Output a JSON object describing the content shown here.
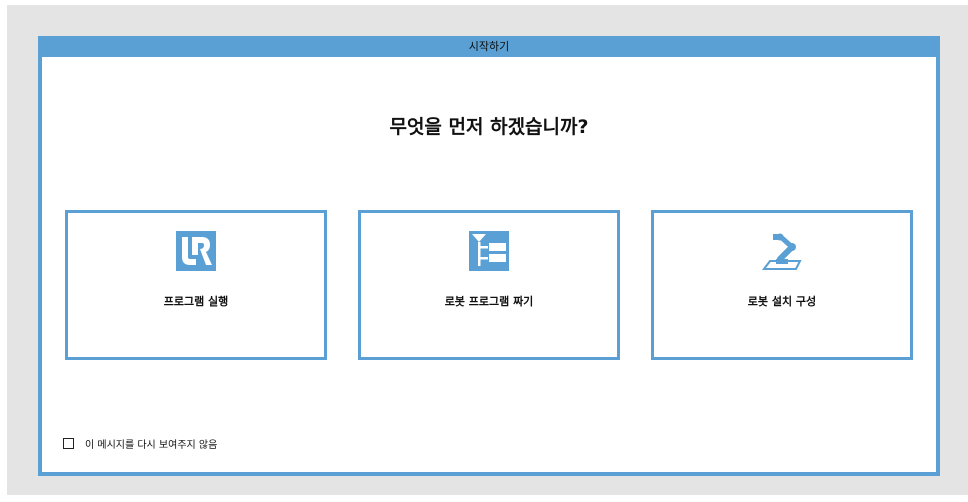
{
  "colors": {
    "accent": "#5aa0d4",
    "background": "#e4e4e4",
    "text": "#111111"
  },
  "dialog": {
    "title": "시작하기",
    "question": "무엇을 먼저 하겠습니까?",
    "tiles": [
      {
        "label": "프로그램 실행",
        "icon": "ur-logo-icon"
      },
      {
        "label": "로봇 프로그램 짜기",
        "icon": "program-tree-icon"
      },
      {
        "label": "로봇 설치 구성",
        "icon": "robot-arm-icon"
      }
    ],
    "dont_show_again": {
      "label": "이 메시지를 다시 보여주지 않음",
      "checked": false
    }
  }
}
